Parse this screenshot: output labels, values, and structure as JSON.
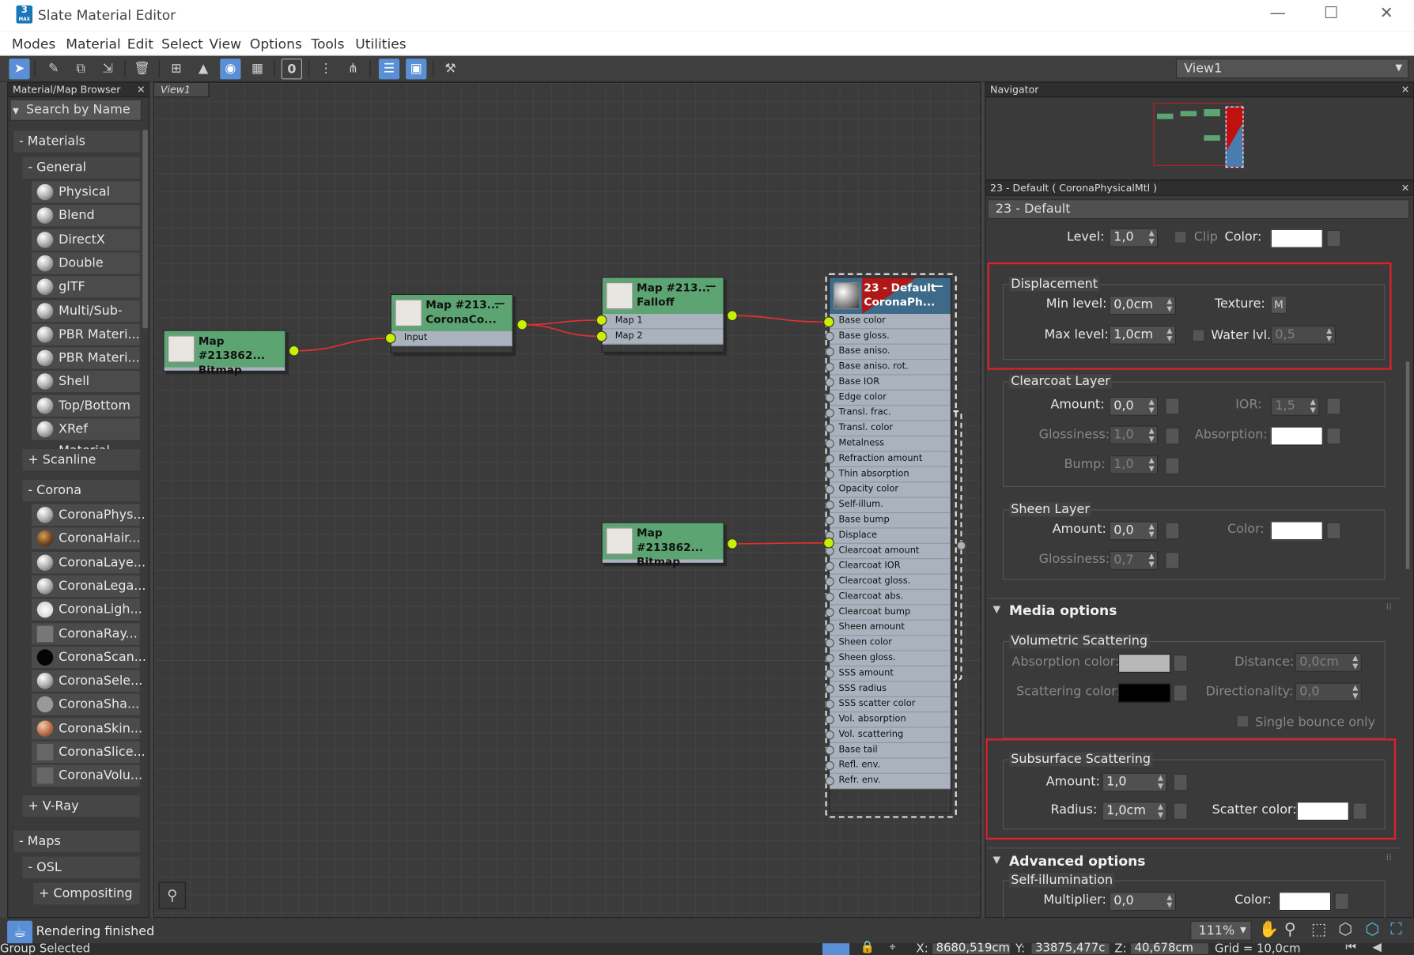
{
  "window": {
    "title": "Slate Material Editor",
    "icon_label": "3",
    "icon_sub": "MAX",
    "minimize": "—",
    "maximize": "☐",
    "close": "✕"
  },
  "menu": [
    "Modes",
    "Material",
    "Edit",
    "Select",
    "View",
    "Options",
    "Tools",
    "Utilities"
  ],
  "toolbar": {
    "view_dropdown": "View1",
    "digit": "0"
  },
  "browser": {
    "title": "Material/Map Browser",
    "search_placeholder": "Search by Name ...",
    "materials": "- Materials",
    "general": "- General",
    "general_items": [
      "Physical Ma...",
      "Blend",
      "DirectX Sha...",
      "Double Sided",
      "glTF Material",
      "Multi/Sub-O...",
      "PBR Materi...",
      "PBR Materi...",
      "Shell Material",
      "Top/Bottom",
      "XRef Material"
    ],
    "scanline": "+ Scanline",
    "corona": "- Corona",
    "corona_items": [
      "CoronaPhys...",
      "CoronaHair...",
      "CoronaLaye...",
      "CoronaLega...",
      "CoronaLigh...",
      "CoronaRay...",
      "CoronaScan...",
      "CoronaSele...",
      "CoronaSha...",
      "CoronaSkin...",
      "CoronaSlice...",
      "CoronaVolu..."
    ],
    "vray": "+ V-Ray",
    "maps": "- Maps",
    "osl": "- OSL",
    "compositing": "+ Compositing"
  },
  "view": {
    "tab": "View1"
  },
  "nodes": {
    "bitmap1": {
      "title": "Map #213862...",
      "sub": "Bitmap"
    },
    "corona": {
      "title": "Map #213...",
      "sub": "CoronaCo...",
      "slot": "Input"
    },
    "falloff": {
      "title": "Map #213...",
      "sub": "Falloff",
      "slots": [
        "Map 1",
        "Map 2"
      ]
    },
    "bitmap2": {
      "title": "Map #213862...",
      "sub": "Bitmap"
    },
    "material": {
      "title": "23 - Default",
      "sub": "CoronaPh...",
      "slots": [
        "Base color",
        "Base gloss.",
        "Base aniso.",
        "Base aniso. rot.",
        "Base IOR",
        "Edge color",
        "Transl. frac.",
        "Transl. color",
        "Metalness",
        "Refraction amount",
        "Thin absorption",
        "Opacity color",
        "Self-illum.",
        "Base bump",
        "Displace",
        "Clearcoat amount",
        "Clearcoat IOR",
        "Clearcoat gloss.",
        "Clearcoat abs.",
        "Clearcoat bump",
        "Sheen amount",
        "Sheen color",
        "Sheen gloss.",
        "SSS amount",
        "SSS radius",
        "SSS scatter color",
        "Vol. absorption",
        "Vol. scattering",
        "Base tail",
        "Refl. env.",
        "Refr. env."
      ]
    }
  },
  "navigator": {
    "title": "Navigator"
  },
  "props": {
    "header": "23 - Default  ( CoronaPhysicalMtl )",
    "name": "23 - Default",
    "level": {
      "label": "Level:",
      "value": "1,0",
      "clip": "Clip",
      "color": "Color:"
    },
    "displacement": {
      "title": "Displacement",
      "min_label": "Min level:",
      "min": "0,0cm",
      "texture": "Texture:",
      "texture_btn": "M",
      "max_label": "Max level:",
      "max": "1,0cm",
      "water": "Water lvl.",
      "water_val": "0,5"
    },
    "clearcoat": {
      "title": "Clearcoat Layer",
      "amount_label": "Amount:",
      "amount": "0,0",
      "ior_label": "IOR:",
      "ior": "1,5",
      "gloss_label": "Glossiness:",
      "gloss": "1,0",
      "abs_label": "Absorption:",
      "bump_label": "Bump:",
      "bump": "1,0"
    },
    "sheen": {
      "title": "Sheen Layer",
      "amount_label": "Amount:",
      "amount": "0,0",
      "color_label": "Color:",
      "gloss_label": "Glossiness:",
      "gloss": "0,7"
    },
    "media": {
      "title": "Media options",
      "vol": "Volumetric Scattering",
      "abs_color": "Absorption color:",
      "distance_label": "Distance:",
      "distance": "0,0cm",
      "scat_color": "Scattering color:",
      "dir_label": "Directionality:",
      "dir": "0,0",
      "single": "Single bounce only"
    },
    "sss": {
      "title": "Subsurface Scattering",
      "amount_label": "Amount:",
      "amount": "1,0",
      "radius_label": "Radius:",
      "radius": "1,0cm",
      "scatter_label": "Scatter color:"
    },
    "advanced": {
      "title": "Advanced options",
      "selfillum": "Self-illumination",
      "mult_label": "Multiplier:",
      "mult": "0,0",
      "color_label": "Color:"
    }
  },
  "status": {
    "rendering": "Rendering finished",
    "zoom": "111%",
    "group": "Group Selected",
    "x_label": "X:",
    "x": "8680,519cm",
    "y_label": "Y:",
    "y": "33875,477c",
    "z_label": "Z:",
    "z": "40,678cm",
    "grid": "Grid = 10,0cm"
  }
}
